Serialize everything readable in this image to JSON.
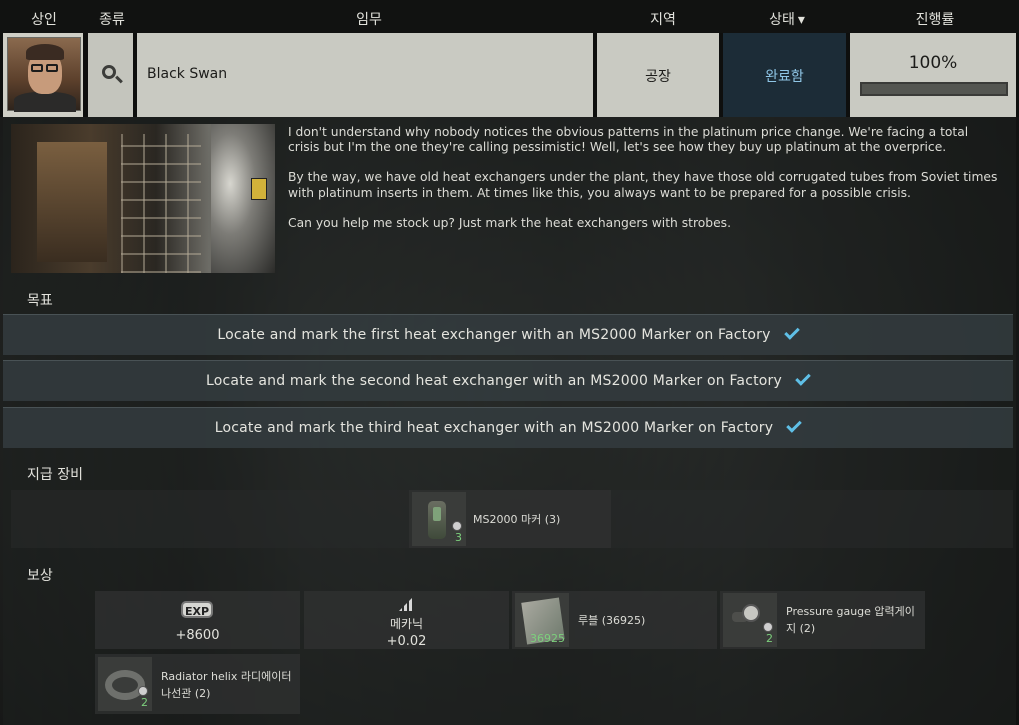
{
  "header": {
    "col_trader": "상인",
    "col_type": "종류",
    "col_task": "임무",
    "col_location": "지역",
    "col_status": "상태",
    "col_progress": "진행률"
  },
  "task": {
    "name": "Black Swan",
    "location": "공장",
    "status": "완료함",
    "progress_text": "100%",
    "progress_fraction": 1.0
  },
  "description": [
    "I don't understand why nobody notices the obvious patterns in the platinum price change. We're facing a total crisis but I'm the one they're calling pessimistic! Well, let's see how they buy up platinum at the overprice.",
    "By the way, we have old heat exchangers under the plant, they have those old corrugated tubes from Soviet times with platinum inserts in them. At times like this, you always want to be prepared for a possible crisis.",
    "Can you help me stock up? Just mark the heat exchangers with strobes."
  ],
  "objectives_title": "목표",
  "objectives": [
    {
      "text": "Locate and mark the first heat exchanger with an MS2000 Marker on Factory",
      "done": true
    },
    {
      "text": "Locate and mark the second heat exchanger with an MS2000 Marker on Factory",
      "done": true
    },
    {
      "text": "Locate and mark the third heat exchanger with an MS2000 Marker on Factory",
      "done": true
    }
  ],
  "equipment_title": "지급 장비",
  "equipment": [
    {
      "icon": "ms2000-marker-icon",
      "label": "MS2000 마커",
      "count": "(3)",
      "qty": "3"
    }
  ],
  "rewards_title": "보상",
  "rewards": {
    "exp": {
      "badge": "EXP",
      "value": "+8600"
    },
    "skill": {
      "label": "메카닉",
      "value": "+0.02"
    },
    "roubles": {
      "label": "루블",
      "count": "(36925)",
      "qty": "36925"
    },
    "gauge": {
      "label": "Pressure gauge 압력게이지",
      "count": "(2)",
      "qty": "2"
    },
    "helix": {
      "label": "Radiator helix 라디에이터 나선관",
      "count": "(2)",
      "qty": "2"
    }
  },
  "colors": {
    "status_bg": "#1c2c37",
    "status_text": "#8fc6e6",
    "check": "#5fbfe6",
    "qty_green": "#7dd07d"
  }
}
